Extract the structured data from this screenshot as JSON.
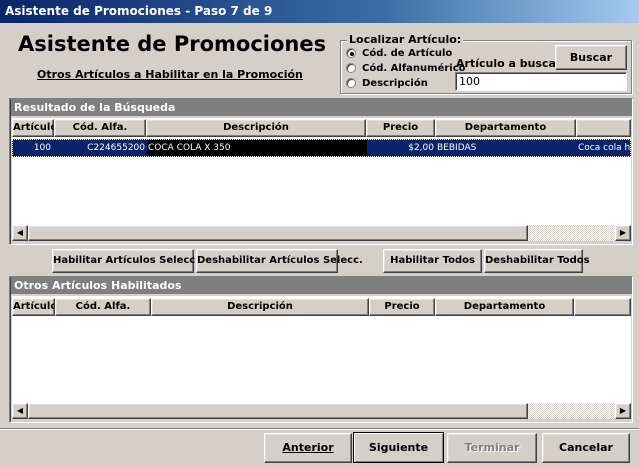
{
  "window": {
    "title": "Asistente de Promociones - Paso 7 de 9"
  },
  "header": {
    "title": "Asistente de Promociones",
    "subtitle": "Otros Artículos a Habilitar en la Promoción"
  },
  "search": {
    "group_label": "Localizar Artículo:",
    "options": [
      "Cód. de Artículo",
      "Cód. Alfanumérico",
      "Descripción"
    ],
    "selected_option": "Cód. de Artículo",
    "input_label": "Artículo a buscar:",
    "input_value": "100",
    "button_label": "Buscar"
  },
  "results": {
    "title": "Resultado de la Búsqueda",
    "columns": [
      "Artículo",
      "Cód. Alfa.",
      "Descripción",
      "Precio",
      "Departamento"
    ],
    "rows": [
      {
        "articulo": "100",
        "cod_alfa": "C224655200",
        "descripcion": "COCA COLA X 350",
        "precio": "$2,00",
        "departamento": "BEBIDAS",
        "extra": "Coca cola he"
      }
    ]
  },
  "actions": {
    "habilitar_selecc": "Habilitar Artículos Selecc.",
    "deshabilitar_selecc": "Deshabilitar Artículos Selecc.",
    "habilitar_todos": "Habilitar Todos",
    "deshabilitar_todos": "Deshabilitar Todos"
  },
  "enabled": {
    "title": "Otros Artículos Habilitados",
    "columns": [
      "Artículo",
      "Cód. Alfa.",
      "Descripción",
      "Precio",
      "Departamento"
    ]
  },
  "nav": {
    "anterior": "Anterior",
    "siguiente": "Siguiente",
    "terminar": "Terminar",
    "cancelar": "Cancelar"
  },
  "colors": {
    "title_bar": "#0a246a",
    "selection": "#0a246a",
    "face": "#d4d0c8",
    "panel_header": "#7f7f7f"
  }
}
